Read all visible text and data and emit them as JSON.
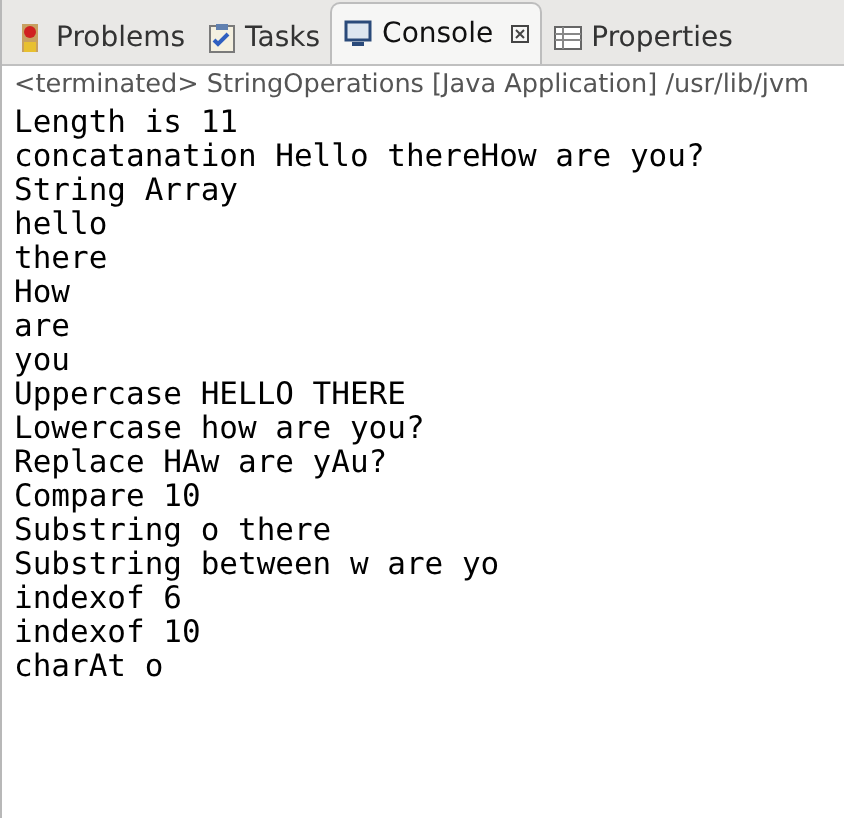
{
  "tabs": [
    {
      "label": "Problems",
      "kind": "problems",
      "selected": false
    },
    {
      "label": "Tasks",
      "kind": "tasks",
      "selected": false
    },
    {
      "label": "Console",
      "kind": "console",
      "selected": true,
      "closable": true
    },
    {
      "label": "Properties",
      "kind": "properties",
      "selected": false
    }
  ],
  "console": {
    "header": "<terminated> StringOperations [Java Application] /usr/lib/jvm",
    "lines": [
      "Length is 11",
      "concatanation Hello thereHow are you?",
      "String Array",
      "hello",
      "there",
      "How",
      "are",
      "you",
      "Uppercase HELLO THERE",
      "Lowercase how are you?",
      "Replace HAw are yAu?",
      "Compare 10",
      "Substring o there",
      "Substring between w are yo",
      "indexof 6",
      "indexof 10",
      "charAt o"
    ]
  }
}
